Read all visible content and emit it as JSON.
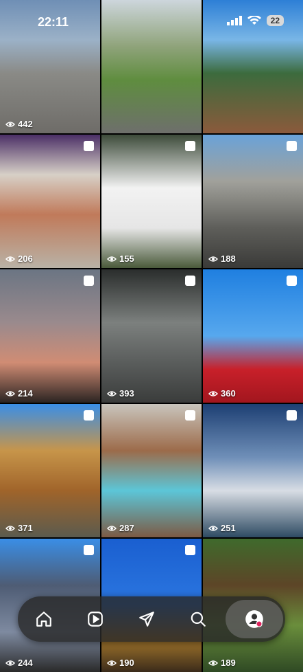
{
  "status_bar": {
    "time": "22:11",
    "battery": "22"
  },
  "grid": [
    {
      "views": "442",
      "multi": false,
      "bg": "linear-gradient(180deg,#6f8fb5 0%,#9bb1c7 30%,#8a8a86 55%,#6e6c68 100%)"
    },
    {
      "views": "",
      "multi": false,
      "bg": "linear-gradient(180deg,#cdd6dc 0%,#8fa37a 35%,#5f8d3f 60%,#6e6f6c 100%)"
    },
    {
      "views": "",
      "multi": false,
      "bg": "linear-gradient(180deg,#2d7fd6 0%,#79b6e6 30%,#3c6b3d 55%,#8b5a3c 100%)"
    },
    {
      "views": "206",
      "multi": true,
      "bg": "linear-gradient(180deg,#4b2f66 0%,#d7d0c7 30%,#c07a5a 60%,#b9b2a6 100%)"
    },
    {
      "views": "155",
      "multi": true,
      "bg": "linear-gradient(180deg,#3d4b3a 0%,#f2f2f2 40%,#e6e6e6 70%,#4a5a3a 100%)"
    },
    {
      "views": "188",
      "multi": true,
      "bg": "linear-gradient(180deg,#6aa2d8 0%,#a1a19b 35%,#5e5e5a 70%,#3a3a38 100%)"
    },
    {
      "views": "214",
      "multi": true,
      "bg": "linear-gradient(180deg,#6b7583 0%,#9a8a8d 40%,#d08c74 70%,#2b2422 100%)"
    },
    {
      "views": "393",
      "multi": true,
      "bg": "linear-gradient(180deg,#2a2d2c 0%,#7c807e 40%,#5a5d5c 70%,#3a3c3b 100%)"
    },
    {
      "views": "360",
      "multi": true,
      "bg": "linear-gradient(180deg,#1f7fe0 0%,#57a8ee 50%,#c8202a 75%,#a2161e 100%)"
    },
    {
      "views": "371",
      "multi": true,
      "bg": "linear-gradient(180deg,#3a8ee6 0%,#c7954a 35%,#a0642a 65%,#5b5b4e 100%)"
    },
    {
      "views": "287",
      "multi": true,
      "bg": "linear-gradient(180deg,#c9c5bd 0%,#9c6b4a 35%,#5cc6d8 65%,#7c5a44 100%)"
    },
    {
      "views": "251",
      "multi": true,
      "bg": "linear-gradient(180deg,#1d3f73 0%,#6f8fb8 40%,#d8dde4 65%,#2e4b63 100%)"
    },
    {
      "views": "244",
      "multi": true,
      "bg": "linear-gradient(180deg,#3a8ee6 0%,#4e5c74 35%,#7e8aa0 70%,#2a2a2a 100%)"
    },
    {
      "views": "190",
      "multi": true,
      "bg": "linear-gradient(180deg,#1a5fd0 0%,#2b76e0 50%,#a3772c 75%,#3b2b1a 100%)"
    },
    {
      "views": "189",
      "multi": false,
      "bg": "linear-gradient(180deg,#3f6a2c 0%,#5d4527 35%,#6a8e3c 65%,#2f4a24 100%)"
    }
  ],
  "nav": [
    "home-icon",
    "reels-icon",
    "send-icon",
    "search-icon",
    "profile-icon"
  ]
}
